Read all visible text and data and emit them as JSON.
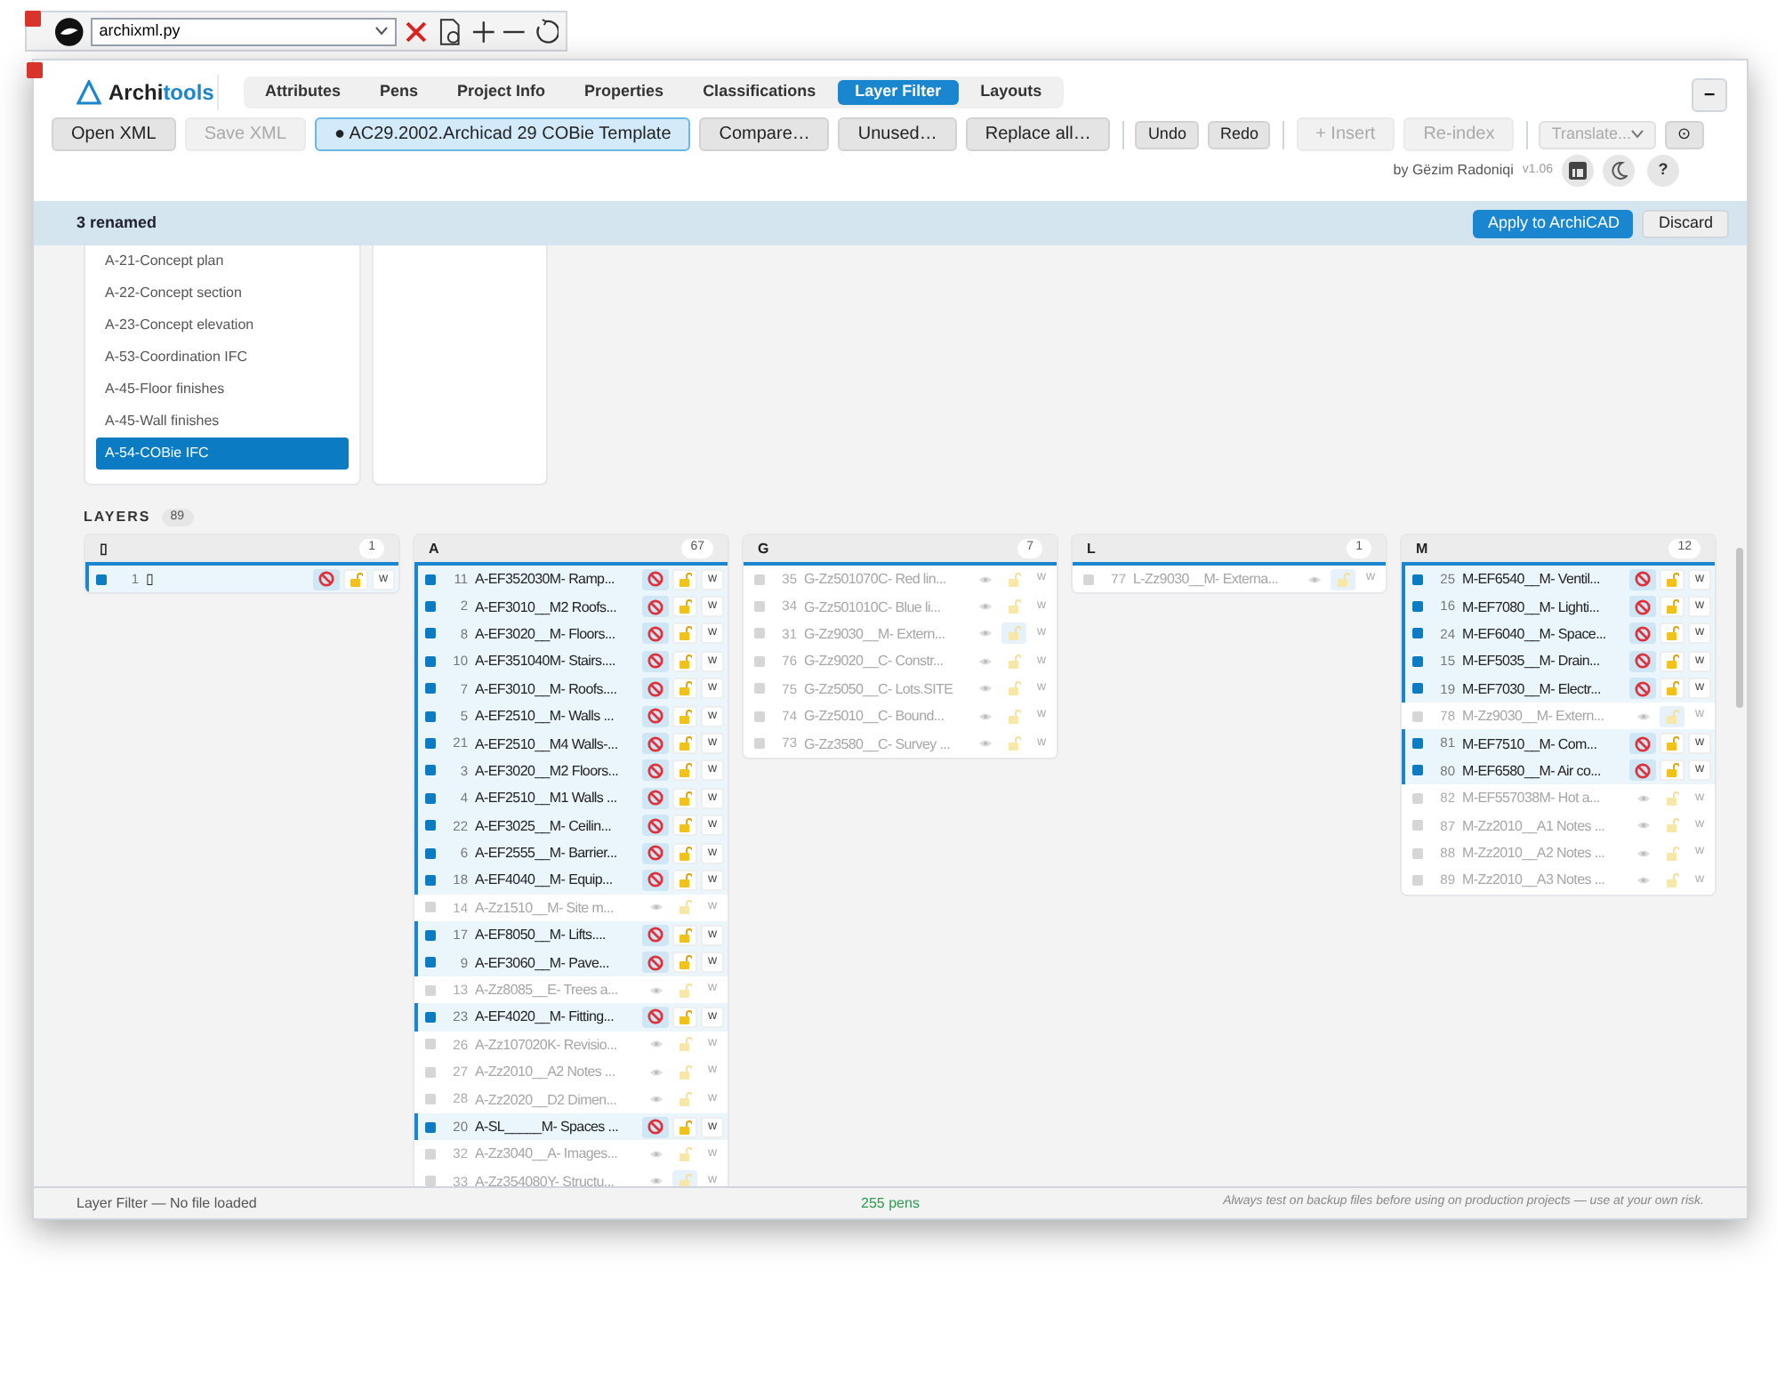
{
  "toolbar": {
    "file": "archixml.py"
  },
  "header": {
    "brand": [
      "Archi",
      "tools"
    ],
    "tabs": [
      {
        "label": "Attributes",
        "selected": false
      },
      {
        "label": "Pens",
        "selected": false
      },
      {
        "label": "Project Info",
        "selected": false
      },
      {
        "label": "Properties",
        "selected": false
      },
      {
        "label": "Classifications",
        "selected": false
      },
      {
        "label": "Layer Filter",
        "selected": true
      },
      {
        "label": "Layouts",
        "selected": false
      }
    ],
    "minimize": "–",
    "button_groups": [
      [
        {
          "label": "Open XML",
          "kind": "normal"
        },
        {
          "label": "Save XML",
          "kind": "disabled"
        },
        {
          "label": "● AC29.2002.Archicad 29 COBie Template",
          "kind": "active"
        },
        {
          "label": "Compare…",
          "kind": "normal"
        },
        {
          "label": "Unused…",
          "kind": "normal"
        },
        {
          "label": "Replace all…",
          "kind": "normal"
        }
      ],
      [
        {
          "label": "Undo",
          "kind": "small"
        },
        {
          "label": "Redo",
          "kind": "small"
        }
      ],
      [
        {
          "label": "+ Insert",
          "kind": "disabled"
        },
        {
          "label": "Re-index",
          "kind": "disabled"
        }
      ],
      [
        {
          "label": "Translate...",
          "kind": "select"
        },
        {
          "label": "⊙",
          "kind": "small"
        }
      ]
    ],
    "author": "by Gëzim Radoniqi",
    "version": "v1.06",
    "help": "?"
  },
  "notice": {
    "text": "3 renamed",
    "buttons": [
      {
        "label": "Apply to ArchiCAD",
        "kind": "primary"
      },
      {
        "label": "Discard",
        "kind": "normal"
      }
    ]
  },
  "views": [
    {
      "label": "A-21-Concept plan",
      "selected": false
    },
    {
      "label": "A-22-Concept section",
      "selected": false
    },
    {
      "label": "A-23-Concept elevation",
      "selected": false
    },
    {
      "label": "A-53-Coordination IFC",
      "selected": false
    },
    {
      "label": "A-45-Floor finishes",
      "selected": false
    },
    {
      "label": "A-45-Wall finishes",
      "selected": false
    },
    {
      "label": "A-54-COBie IFC",
      "selected": true
    }
  ],
  "layers": {
    "title": "LAYERS",
    "count": "89",
    "groups": [
      {
        "title": "▯",
        "count": "1",
        "rows": [
          {
            "n": "1",
            "name": "▯",
            "selected": true,
            "locked": false,
            "flag": "w"
          }
        ]
      },
      {
        "title": "A",
        "count": "67",
        "rows": [
          {
            "n": "11",
            "name": "A-EF352030M- Ramp...",
            "selected": true,
            "locked": false,
            "flag": "w"
          },
          {
            "n": "2",
            "name": "A-EF3010__M2 Roofs...",
            "selected": true,
            "locked": false,
            "flag": "w"
          },
          {
            "n": "8",
            "name": "A-EF3020__M- Floors...",
            "selected": true,
            "locked": false,
            "flag": "w"
          },
          {
            "n": "10",
            "name": "A-EF351040M- Stairs....",
            "selected": true,
            "locked": false,
            "flag": "w"
          },
          {
            "n": "7",
            "name": "A-EF3010__M- Roofs....",
            "selected": true,
            "locked": false,
            "flag": "w"
          },
          {
            "n": "5",
            "name": "A-EF2510__M- Walls ...",
            "selected": true,
            "locked": false,
            "flag": "w"
          },
          {
            "n": "21",
            "name": "A-EF2510__M4 Walls-...",
            "selected": true,
            "locked": false,
            "flag": "w"
          },
          {
            "n": "3",
            "name": "A-EF3020__M2 Floors...",
            "selected": true,
            "locked": false,
            "flag": "w"
          },
          {
            "n": "4",
            "name": "A-EF2510__M1 Walls ...",
            "selected": true,
            "locked": false,
            "flag": "w"
          },
          {
            "n": "22",
            "name": "A-EF3025__M- Ceilin...",
            "selected": true,
            "locked": false,
            "flag": "w"
          },
          {
            "n": "6",
            "name": "A-EF2555__M- Barrier...",
            "selected": true,
            "locked": false,
            "flag": "w"
          },
          {
            "n": "18",
            "name": "A-EF4040__M- Equip...",
            "selected": true,
            "locked": false,
            "flag": "w"
          },
          {
            "n": "14",
            "name": "A-Zz1510__M- Site m...",
            "selected": false,
            "locked": false,
            "flag": "w"
          },
          {
            "n": "17",
            "name": "A-EF8050__M- Lifts....",
            "selected": true,
            "locked": false,
            "flag": "w"
          },
          {
            "n": "9",
            "name": "A-EF3060__M- Pave...",
            "selected": true,
            "locked": false,
            "flag": "w"
          },
          {
            "n": "13",
            "name": "A-Zz8085__E- Trees a...",
            "selected": false,
            "locked": false,
            "flag": "w"
          },
          {
            "n": "23",
            "name": "A-EF4020__M- Fitting...",
            "selected": true,
            "locked": false,
            "flag": "w"
          },
          {
            "n": "26",
            "name": "A-Zz107020K- Revisio...",
            "selected": false,
            "locked": false,
            "flag": "w"
          },
          {
            "n": "27",
            "name": "A-Zz2010__A2 Notes ...",
            "selected": false,
            "locked": false,
            "flag": "w"
          },
          {
            "n": "28",
            "name": "A-Zz2020__D2 Dimen...",
            "selected": false,
            "locked": false,
            "flag": "w"
          },
          {
            "n": "20",
            "name": "A-SL_____M- Spaces ...",
            "selected": true,
            "locked": false,
            "flag": "w"
          },
          {
            "n": "32",
            "name": "A-Zz3040__A- Images...",
            "selected": false,
            "locked": false,
            "flag": "w"
          },
          {
            "n": "33",
            "name": "A-Zz354080Y- Structu...",
            "selected": false,
            "locked": true,
            "flag": "w"
          }
        ]
      },
      {
        "title": "G",
        "count": "7",
        "rows": [
          {
            "n": "35",
            "name": "G-Zz501070C- Red lin...",
            "selected": false,
            "locked": false,
            "flag": "w"
          },
          {
            "n": "34",
            "name": "G-Zz501010C- Blue li...",
            "selected": false,
            "locked": false,
            "flag": "w"
          },
          {
            "n": "31",
            "name": "G-Zz9030__M- Extern...",
            "selected": false,
            "locked": true,
            "flag": "w"
          },
          {
            "n": "76",
            "name": "G-Zz9020__C- Constr...",
            "selected": false,
            "locked": false,
            "flag": "w"
          },
          {
            "n": "75",
            "name": "G-Zz5050__C- Lots.SITE",
            "selected": false,
            "locked": false,
            "flag": "w"
          },
          {
            "n": "74",
            "name": "G-Zz5010__C- Bound...",
            "selected": false,
            "locked": false,
            "flag": "w"
          },
          {
            "n": "73",
            "name": "G-Zz3580__C- Survey ...",
            "selected": false,
            "locked": false,
            "flag": "w"
          }
        ]
      },
      {
        "title": "L",
        "count": "1",
        "rows": [
          {
            "n": "77",
            "name": "L-Zz9030__M- Externa...",
            "selected": false,
            "locked": true,
            "flag": "w"
          }
        ]
      },
      {
        "title": "M",
        "count": "12",
        "rows": [
          {
            "n": "25",
            "name": "M-EF6540__M- Ventil...",
            "selected": true,
            "locked": false,
            "flag": "w"
          },
          {
            "n": "16",
            "name": "M-EF7080__M- Lighti...",
            "selected": true,
            "locked": false,
            "flag": "w"
          },
          {
            "n": "24",
            "name": "M-EF6040__M- Space...",
            "selected": true,
            "locked": false,
            "flag": "w"
          },
          {
            "n": "15",
            "name": "M-EF5035__M- Drain...",
            "selected": true,
            "locked": false,
            "flag": "w"
          },
          {
            "n": "19",
            "name": "M-EF7030__M- Electr...",
            "selected": true,
            "locked": false,
            "flag": "w"
          },
          {
            "n": "78",
            "name": "M-Zz9030__M- Extern...",
            "selected": false,
            "locked": true,
            "flag": "w"
          },
          {
            "n": "81",
            "name": "M-EF7510__M- Com...",
            "selected": true,
            "locked": false,
            "flag": "w"
          },
          {
            "n": "80",
            "name": "M-EF6580__M- Air co...",
            "selected": true,
            "locked": false,
            "flag": "w"
          },
          {
            "n": "82",
            "name": "M-EF557038M- Hot a...",
            "selected": false,
            "locked": false,
            "flag": "w"
          },
          {
            "n": "87",
            "name": "M-Zz2010__A1 Notes ...",
            "selected": false,
            "locked": false,
            "flag": "w"
          },
          {
            "n": "88",
            "name": "M-Zz2010__A2 Notes ...",
            "selected": false,
            "locked": false,
            "flag": "w"
          },
          {
            "n": "89",
            "name": "M-Zz2010__A3 Notes ...",
            "selected": false,
            "locked": false,
            "flag": "w"
          }
        ]
      }
    ]
  },
  "status_bar": {
    "left": "Layer Filter — No file loaded",
    "center": "255 pens",
    "right": "Always test on backup files before using on production projects — use at your own risk."
  }
}
